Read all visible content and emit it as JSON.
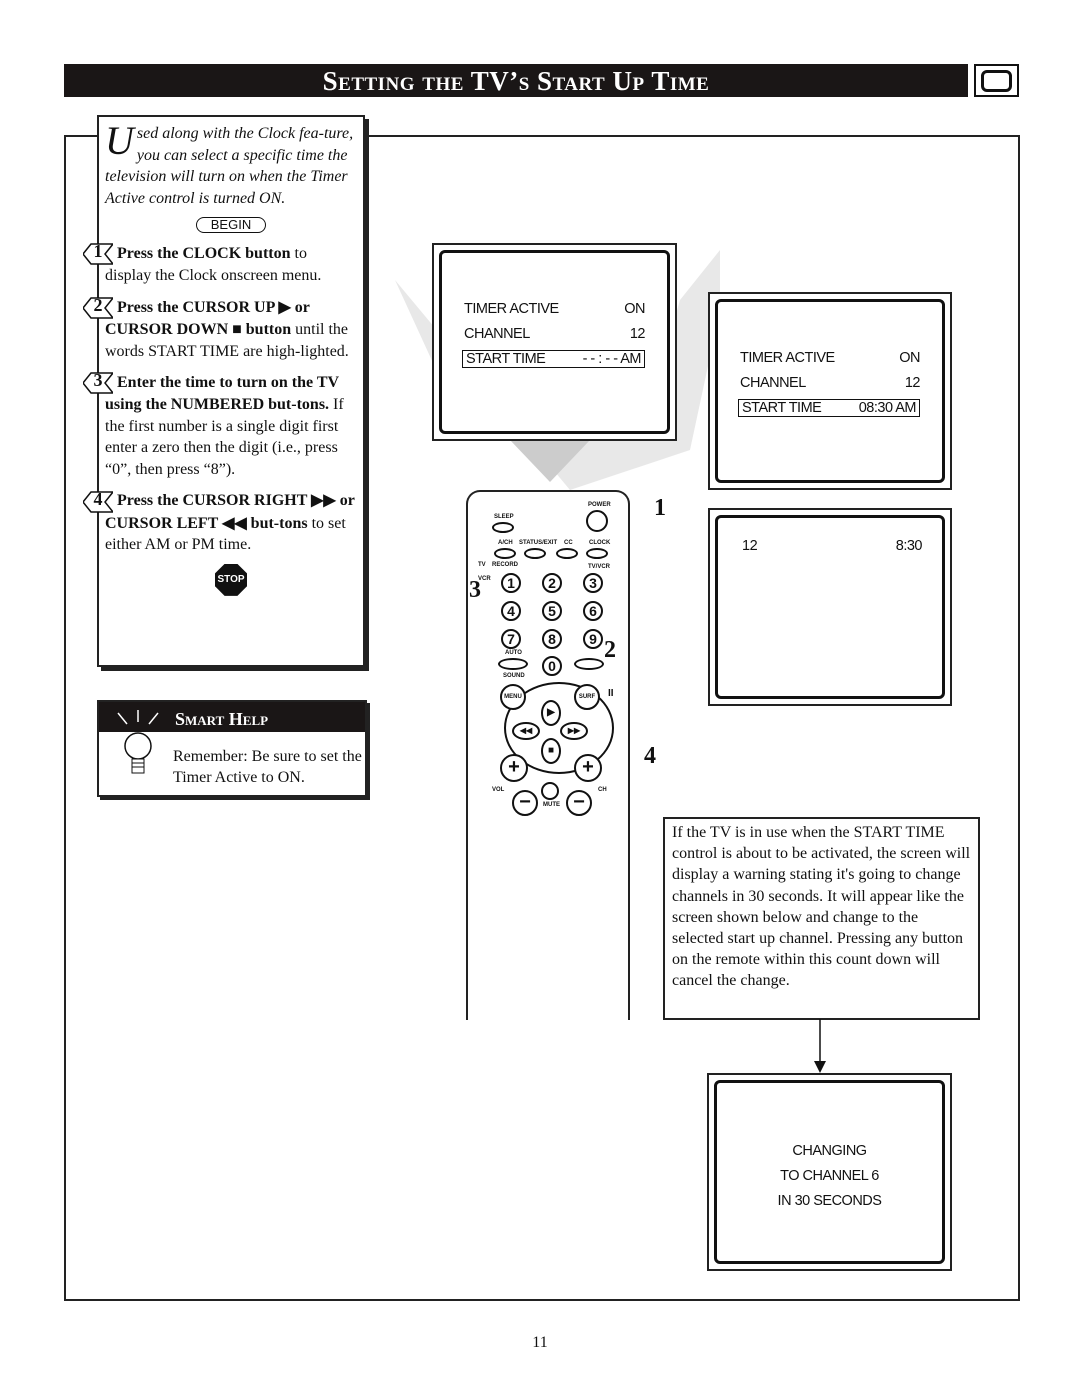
{
  "header": {
    "title": "Setting the TV’s Start Up Time",
    "icon": "tv-icon"
  },
  "sidebar": {
    "intro_dropcap": "U",
    "intro": "sed along with the Clock fea-ture, you can select a specific time the television will turn on when the Timer Active control is turned ON.",
    "begin": "BEGIN",
    "steps": [
      {
        "num": "1",
        "bold": "Press the CLOCK button",
        "text": " to display the Clock onscreen menu."
      },
      {
        "num": "2",
        "bold": "Press the CURSOR UP ▶ or CURSOR DOWN ■ button",
        "text": " until the words START TIME are high-lighted."
      },
      {
        "num": "3",
        "bold": "Enter the time to turn on the TV using the NUMBERED but-tons.",
        "text": " If the first number is a single digit first enter a zero then the digit (i.e., press “0”, then press “8”)."
      },
      {
        "num": "4",
        "bold": "Press the CURSOR RIGHT ▶▶ or CURSOR LEFT ◀◀ but-tons",
        "text": " to set either AM or PM time."
      }
    ],
    "stop": "STOP"
  },
  "smart_help": {
    "title": "Smart Help",
    "text": "Remember: Be sure to set the Timer Active to ON."
  },
  "screen1": {
    "rows": [
      [
        "TIMER ACTIVE",
        "ON"
      ],
      [
        "CHANNEL",
        "12"
      ],
      [
        "START TIME",
        "- - : - - AM"
      ]
    ]
  },
  "screen2": {
    "rows": [
      [
        "TIMER ACTIVE",
        "ON"
      ],
      [
        "CHANNEL",
        "12"
      ],
      [
        "START TIME",
        "08:30 AM"
      ]
    ]
  },
  "screen3": {
    "channel": "12",
    "time": "8:30"
  },
  "note": "If the TV is in use when the START TIME control is about to be activated, the screen will display a warning stating it's going to change channels in 30 seconds. It will appear like the screen shown below and change to the selected start up channel. Pressing any button on the remote within this count down will cancel the change.",
  "screen4": {
    "lines": [
      "CHANGING",
      "TO CHANNEL 6",
      "IN 30 SECONDS"
    ]
  },
  "remote": {
    "power": "POWER",
    "sleep": "SLEEP",
    "ach": "A/CH",
    "status": "STATUS/EXIT",
    "cc": "CC",
    "clock": "CLOCK",
    "record": "RECORD",
    "tvvcr": "TV/VCR",
    "tv": "TV",
    "vcr": "VCR",
    "digits": [
      "1",
      "2",
      "3",
      "4",
      "5",
      "6",
      "7",
      "8",
      "9",
      "0"
    ],
    "auto": "AUTO",
    "sound": "SOUND",
    "menu": "MENU",
    "surf": "SURF",
    "pause": "II",
    "vol": "VOL",
    "ch": "CH",
    "mute": "MUTE",
    "plus": "+",
    "minus": "−",
    "up": "▶",
    "down": "■",
    "left": "◀◀",
    "right": "▶▶"
  },
  "callouts": [
    "1",
    "2",
    "3",
    "4"
  ],
  "page_number": "11"
}
